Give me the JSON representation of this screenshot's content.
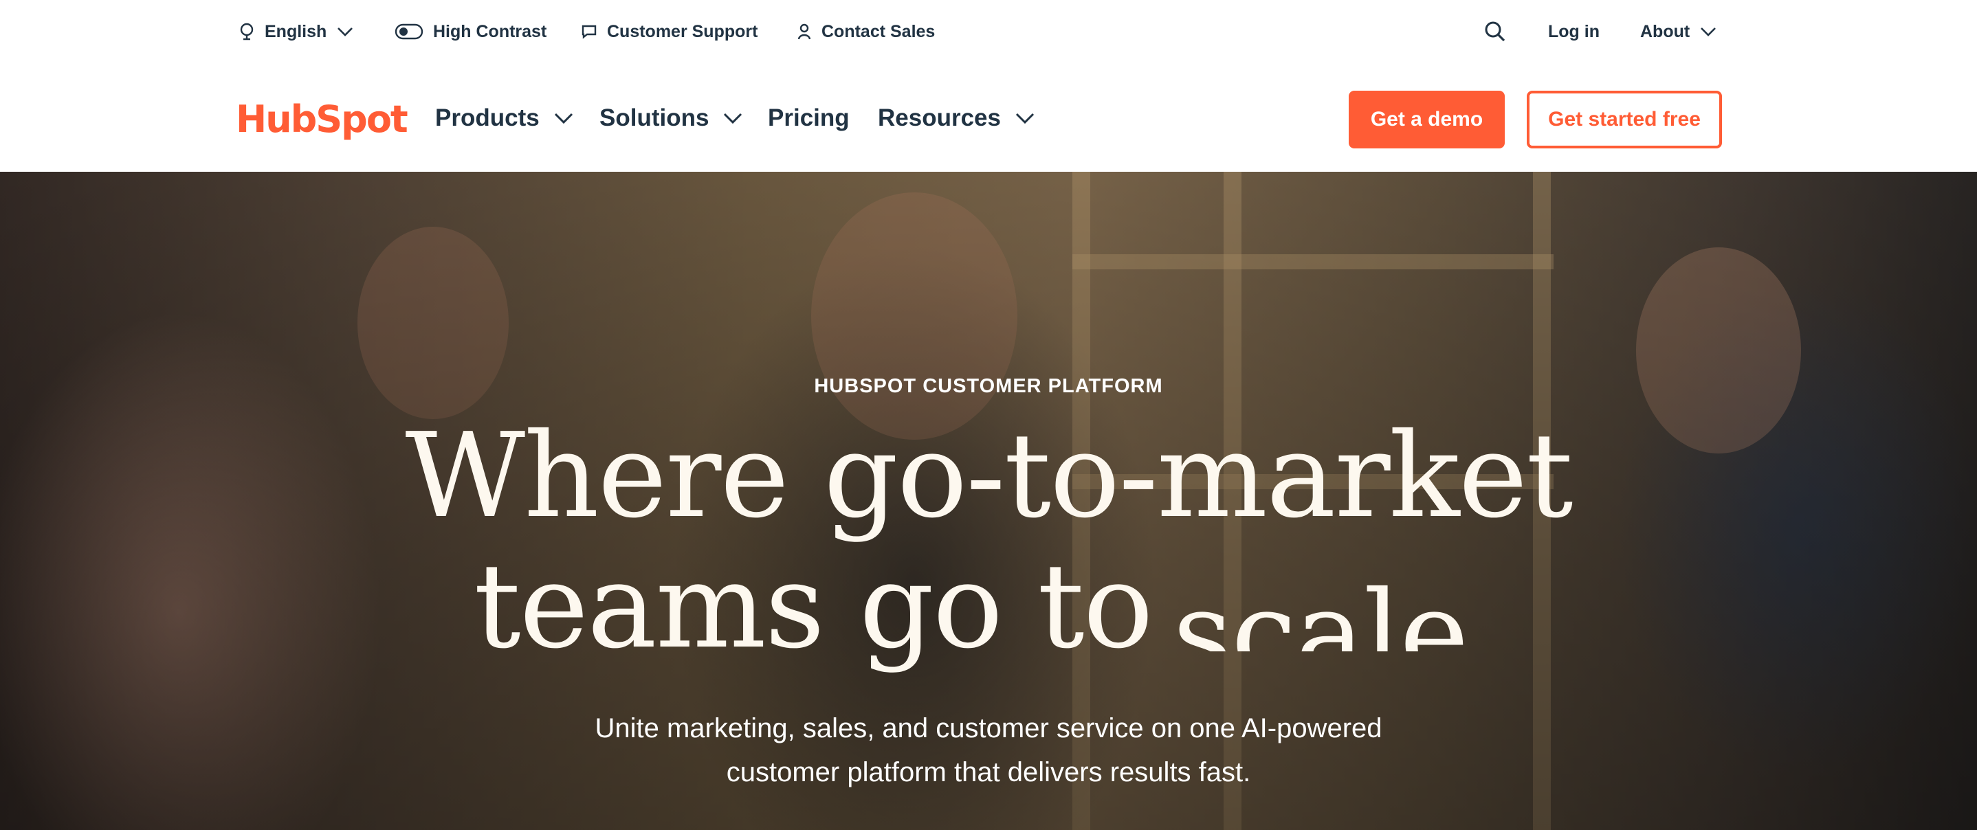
{
  "utility": {
    "language": "English",
    "high_contrast": "High Contrast",
    "customer_support": "Customer Support",
    "contact_sales": "Contact Sales",
    "log_in": "Log in",
    "about": "About"
  },
  "nav": {
    "logo": "HubSpot",
    "items": [
      "Products",
      "Solutions",
      "Pricing",
      "Resources"
    ],
    "demo_button": "Get a demo",
    "free_button": "Get started free"
  },
  "hero": {
    "eyebrow": "HUBSPOT CUSTOMER PLATFORM",
    "headline_line1": "Where go-to-market",
    "headline_line2_start": "teams go to",
    "headline_accent": "scale",
    "headline_dot": ".",
    "subtitle_line1": "Unite marketing, sales, and customer service on one AI-powered",
    "subtitle_line2": "customer platform that delivers results fast."
  },
  "colors": {
    "brand": "#ff5c35",
    "text": "#213343",
    "headline": "#fdf8ef"
  },
  "icons": [
    "globe-icon",
    "toggle-icon",
    "chat-icon",
    "person-icon",
    "search-icon",
    "chevron-down-icon"
  ]
}
